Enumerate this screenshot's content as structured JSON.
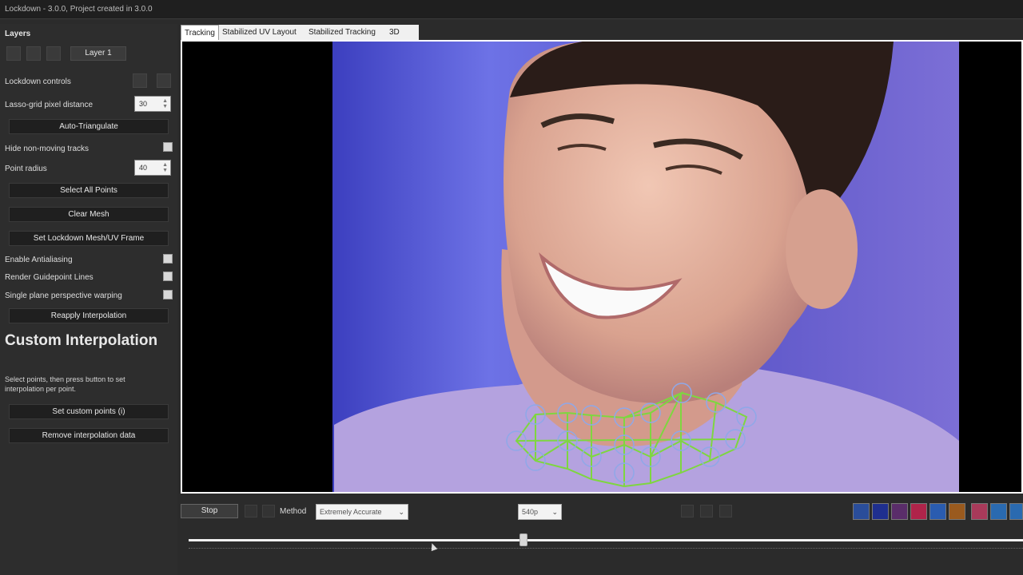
{
  "window": {
    "title": "Lockdown - 3.0.0, Project created in 3.0.0"
  },
  "panel": {
    "layers_header": "Layers",
    "layer_button": "Layer 1",
    "lockdown_controls": "Lockdown controls",
    "lasso_label": "Lasso-grid pixel distance",
    "lasso_value": "30",
    "auto_triangulate": "Auto-Triangulate",
    "hide_tracks": "Hide non-moving tracks",
    "point_radius_label": "Point radius",
    "point_radius_value": "40",
    "select_all": "Select All Points",
    "clear_mesh": "Clear Mesh",
    "set_mesh": "Set Lockdown Mesh/UV Frame",
    "antialiasing": "Enable Antialiasing",
    "guidepoint_lines": "Render Guidepoint Lines",
    "single_plane": "Single plane perspective warping",
    "reapply": "Reapply Interpolation",
    "custom_title": "Custom Interpolation",
    "custom_desc": "Select points, then press button to set interpolation per point.",
    "set_custom_points": "Set custom points (i)",
    "remove_interp": "Remove interpolation data"
  },
  "tabs": [
    "Tracking",
    "Stabilized UV Layout",
    "Stabilized Tracking",
    "3D"
  ],
  "bottom": {
    "stop": "Stop",
    "method_label": "Method",
    "method_value": "Extremely Accurate",
    "resolution_value": "540p"
  },
  "colors": {
    "accent_blue": "#2a4d9a",
    "mesh_green": "#7ed640",
    "point_ring": "#8fa8e8"
  },
  "icons": [
    "back-icon",
    "forward-icon",
    "add-icon",
    "layer-icon",
    "help-icon",
    "settings-icon",
    "play-back-icon",
    "play-forward-icon",
    "pin-icon",
    "circle-icon",
    "brush-icon",
    "grid-icon",
    "lock-icon",
    "link-icon",
    "point-icon",
    "square-icon",
    "arrow-icon"
  ],
  "timeline": {
    "playhead_fraction": 0.4
  }
}
